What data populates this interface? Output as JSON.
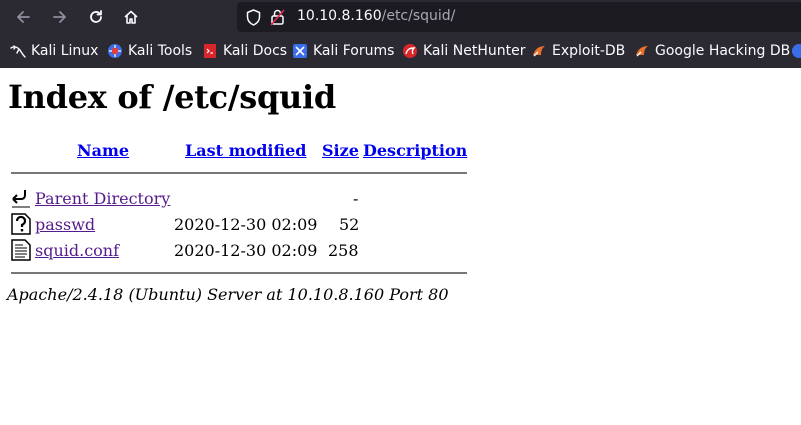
{
  "browser": {
    "url_host": "10.10.8.160",
    "url_path": "/etc/squid/",
    "bookmarks": [
      {
        "label": "Kali Linux",
        "icon": "kali-dragon-icon"
      },
      {
        "label": "Kali Tools",
        "icon": "kali-tools-icon"
      },
      {
        "label": "Kali Docs",
        "icon": "kali-docs-icon"
      },
      {
        "label": "Kali Forums",
        "icon": "kali-forums-icon"
      },
      {
        "label": "Kali NetHunter",
        "icon": "nethunter-icon"
      },
      {
        "label": "Exploit-DB",
        "icon": "exploit-db-icon"
      },
      {
        "label": "Google Hacking DB",
        "icon": "ghdb-icon"
      }
    ]
  },
  "page": {
    "title": "Index of /etc/squid",
    "columns": {
      "name": "Name",
      "last_modified": "Last modified",
      "size": "Size",
      "description": "Description"
    },
    "entries": [
      {
        "name": "Parent Directory",
        "modified": "",
        "size": "-",
        "icon": "back-arrow-icon"
      },
      {
        "name": "passwd",
        "modified": "2020-12-30 02:09",
        "size": "52",
        "icon": "unknown-file-icon"
      },
      {
        "name": "squid.conf",
        "modified": "2020-12-30 02:09",
        "size": "258",
        "icon": "text-file-icon"
      }
    ],
    "footer": "Apache/2.4.18 (Ubuntu) Server at 10.10.8.160 Port 80"
  }
}
